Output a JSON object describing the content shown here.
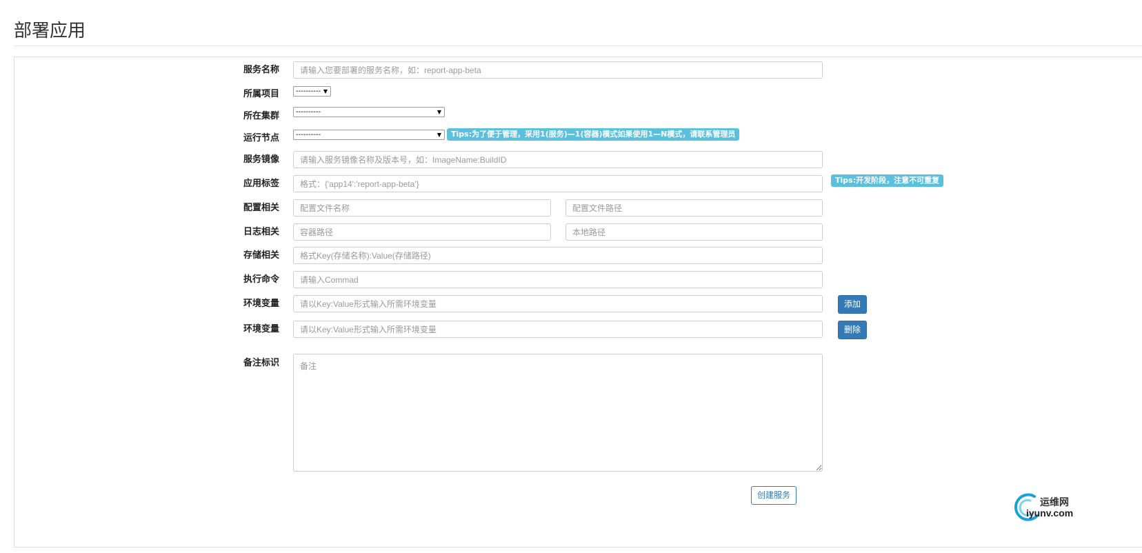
{
  "page": {
    "title": "部署应用"
  },
  "form": {
    "service_name": {
      "label": "服务名称",
      "placeholder": "请输入您要部署的服务名称，如：report-app-beta"
    },
    "project": {
      "label": "所属项目",
      "selected": "----------"
    },
    "cluster": {
      "label": "所在集群",
      "selected": "----------"
    },
    "node": {
      "label": "运行节点",
      "selected": "----------",
      "tip": "Tips:为了便于管理，采用1(服务)—1(容器)模式如果使用1—N模式，请联系管理员"
    },
    "image": {
      "label": "服务镜像",
      "placeholder": "请输入服务镜像名称及版本号，如：ImageName:BuildID"
    },
    "app_label": {
      "label": "应用标签",
      "placeholder": "格式：{'app14':'report-app-beta'}",
      "tip": "Tips:开发阶段，注意不可重复"
    },
    "config": {
      "label": "配置相关",
      "name_placeholder": "配置文件名称",
      "path_placeholder": "配置文件路径"
    },
    "log": {
      "label": "日志相关",
      "container_placeholder": "容器路径",
      "local_placeholder": "本地路径"
    },
    "storage": {
      "label": "存储相关",
      "placeholder": "格式Key(存储名称):Value(存储路径)"
    },
    "command": {
      "label": "执行命令",
      "placeholder": "请输入Commad"
    },
    "env_rows": [
      {
        "label": "环境变量",
        "placeholder": "请以Key:Value形式输入所需环境变量",
        "button": "添加"
      },
      {
        "label": "环境变量",
        "placeholder": "请以Key:Value形式输入所需环境变量",
        "button": "删除"
      }
    ],
    "remark": {
      "label": "备注标识",
      "placeholder": "备注"
    },
    "submit_label": "创建服务"
  },
  "watermark": {
    "cn": "运维网",
    "en": "iyunv.com"
  },
  "colors": {
    "primary": "#337ab7",
    "tip": "#5bc0de",
    "border": "#cccccc"
  }
}
